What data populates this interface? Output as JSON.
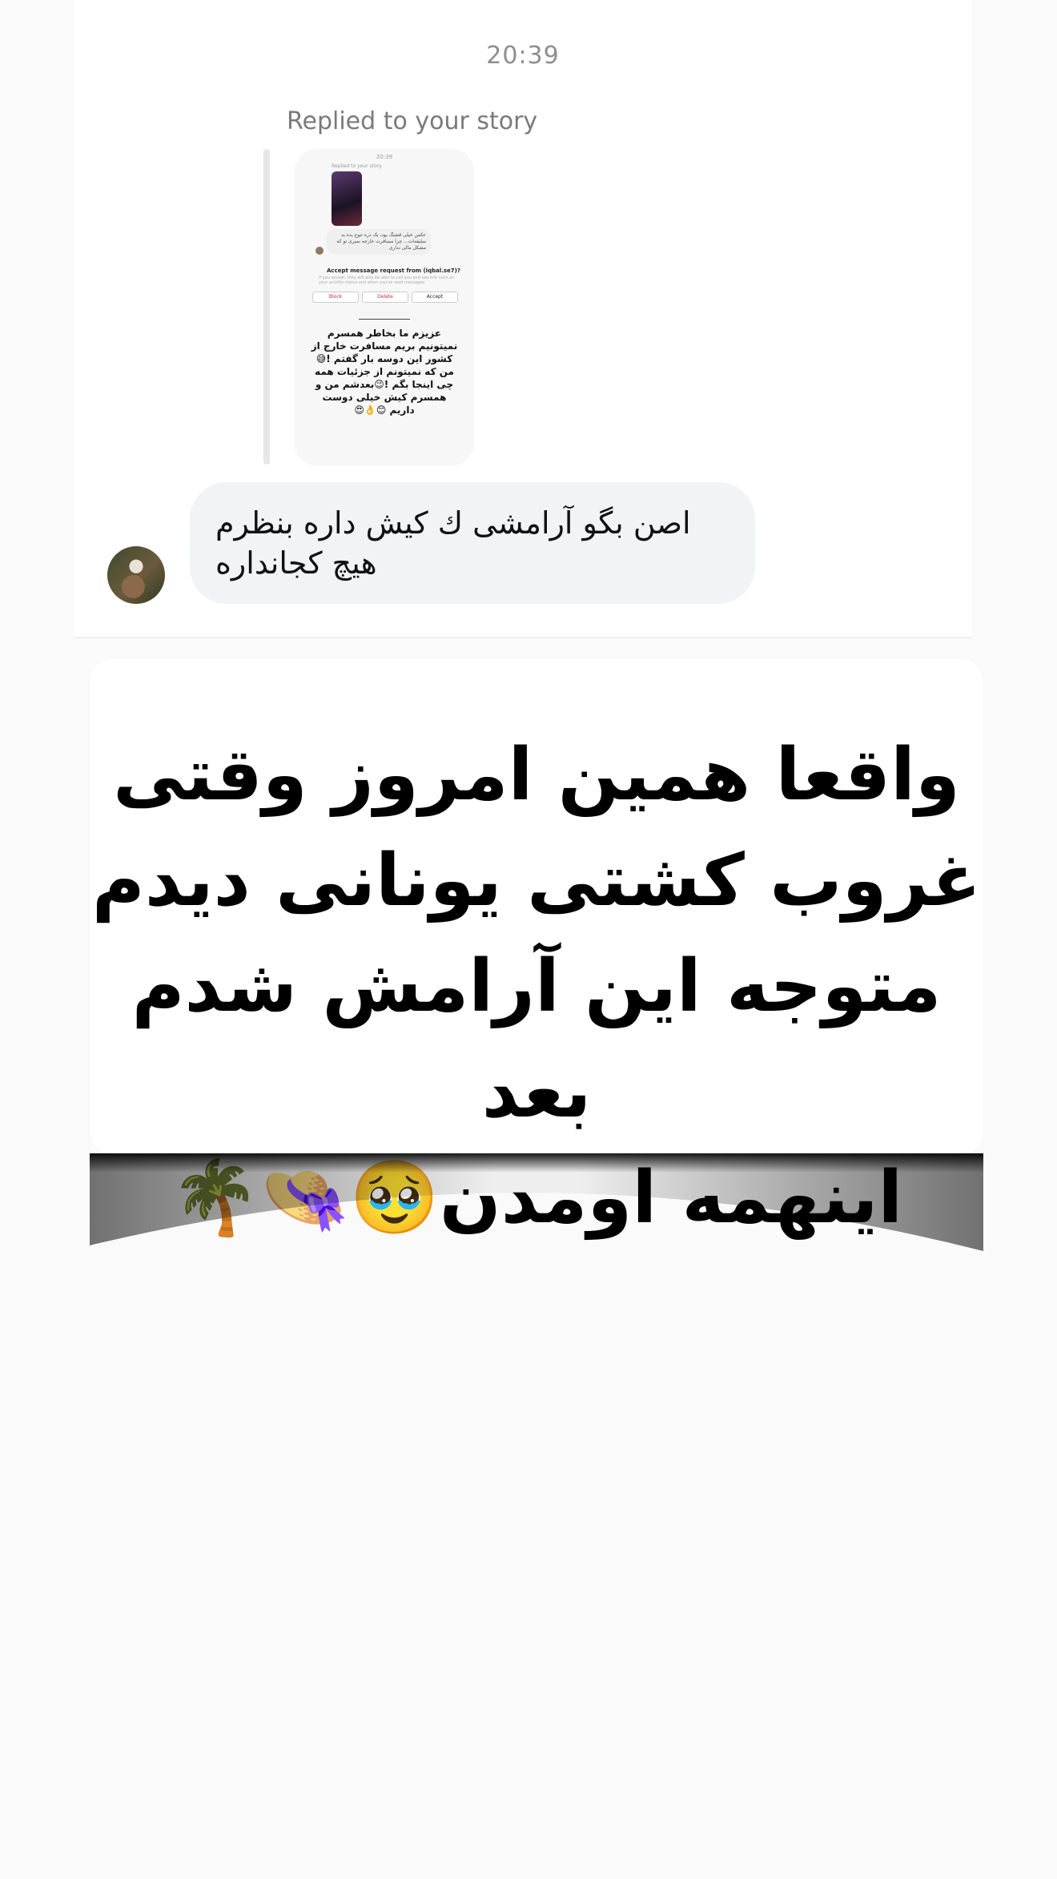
{
  "chat": {
    "timestamp": "20:39",
    "replied_label": "Replied to your story",
    "story_thumbnail": {
      "time": "20:39",
      "replied": "Replied to your story",
      "message": "عکس خیلی قشنگ بود، یک ذره تنوع بده به سلیقه‌ات... چرا مسافرت خارجه نمیری تو که مشکل مالی نداری",
      "accept_title": "Accept message request from (iqbal.se7)?",
      "accept_sub": "If you accept, they will also be able to call you and see info such as your activity status and when you've read messages.",
      "buttons": [
        "Block",
        "Delete",
        "Accept"
      ],
      "story_text": "عزیزم ما بخاطر همسرم نمیتونیم بریم مسافرت خارج از کشور این دوسه بار گفتم !😅من که نمیتونم از جزئیات همه چی اینجا بگم !😉بعدشم من و همسرم کیش خیلی دوست داریم 😊👌😍"
    },
    "reply_message": "اصن بگو آرامشی ك کیش داره بنظرم هیچ کجانداره"
  },
  "overlay": {
    "text_lines": [
      "واقعا همین امروز وقتی",
      "غروب کشتی یونانی دیدم",
      "متوجه این آرامش شدم بعد",
      "اینهمه اومدن🥹👒🌴"
    ]
  }
}
